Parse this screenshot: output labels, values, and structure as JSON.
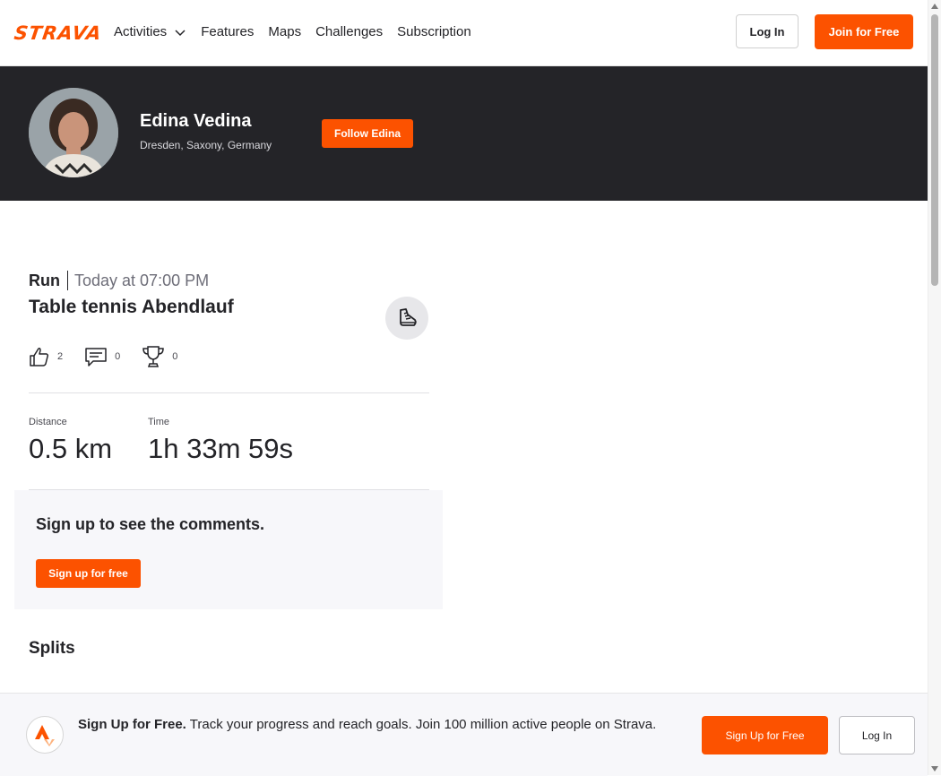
{
  "nav": {
    "logo": "STRAVA",
    "links": {
      "activities": "Activities",
      "features": "Features",
      "maps": "Maps",
      "challenges": "Challenges",
      "subscription": "Subscription"
    },
    "login_label": "Log In",
    "join_label": "Join for Free"
  },
  "athlete": {
    "name": "Edina Vedina",
    "location": "Dresden, Saxony, Germany",
    "follow_label": "Follow Edina"
  },
  "activity": {
    "type": "Run",
    "date": "Today at 07:00 PM",
    "title": "Table tennis Abendlauf",
    "kudos_count": "2",
    "comments_count": "0",
    "achievements_count": "0",
    "stats": {
      "distance_label": "Distance",
      "distance_value": "0.5 km",
      "time_label": "Time",
      "time_value": "1h 33m 59s"
    }
  },
  "comments": {
    "prompt": "Sign up to see the comments.",
    "signup_label": "Sign up for free"
  },
  "splits": {
    "heading": "Splits"
  },
  "banner": {
    "headline": "Sign Up for Free.",
    "body": "Track your progress and reach goals. Join 100 million active people on Strava.",
    "signup_label": "Sign Up for Free",
    "login_label": "Log In"
  },
  "colors": {
    "brand": "#fc5200",
    "header_bg": "#242428"
  },
  "icons": [
    "strava-logo",
    "chevron-down-icon",
    "shoe-icon",
    "thumbs-up-icon",
    "comment-icon",
    "trophy-icon",
    "strava-badge-icon"
  ]
}
